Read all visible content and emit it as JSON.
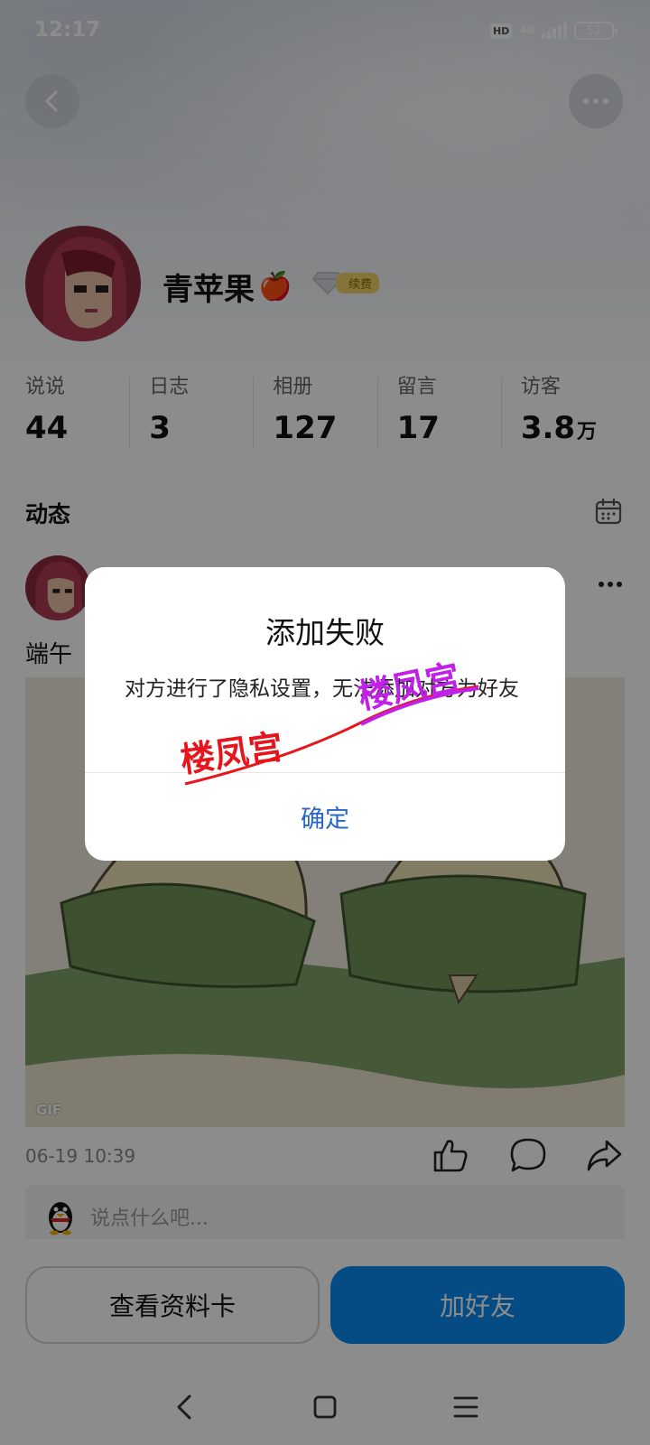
{
  "status_bar": {
    "time": "12:17",
    "hd": "HD",
    "network": "4G",
    "battery": "52"
  },
  "profile": {
    "name": "青苹果",
    "name_emoji": "🍎",
    "vip_label": "续费"
  },
  "stats": [
    {
      "label": "说说",
      "value": "44",
      "unit": ""
    },
    {
      "label": "日志",
      "value": "3",
      "unit": ""
    },
    {
      "label": "相册",
      "value": "127",
      "unit": ""
    },
    {
      "label": "留言",
      "value": "17",
      "unit": ""
    },
    {
      "label": "访客",
      "value": "3.8",
      "unit": "万"
    }
  ],
  "feed": {
    "title": "动态",
    "post": {
      "text": "端午",
      "gif_tag": "GIF",
      "time": "06-19 10:39",
      "comment_placeholder": "说点什么吧..."
    }
  },
  "bottom_actions": {
    "view_card": "查看资料卡",
    "add_friend": "加好友"
  },
  "dialog": {
    "title": "添加失败",
    "message": "对方进行了隐私设置，无法添加对方为好友",
    "confirm": "确定"
  },
  "watermark": {
    "text_1": "楼凤宫",
    "text_2": "楼凤宫"
  },
  "colors": {
    "primary": "#0a8bf0",
    "dialog_link": "#2a64c8",
    "watermark_red": "#e8141c",
    "watermark_purple": "#c020e8"
  }
}
